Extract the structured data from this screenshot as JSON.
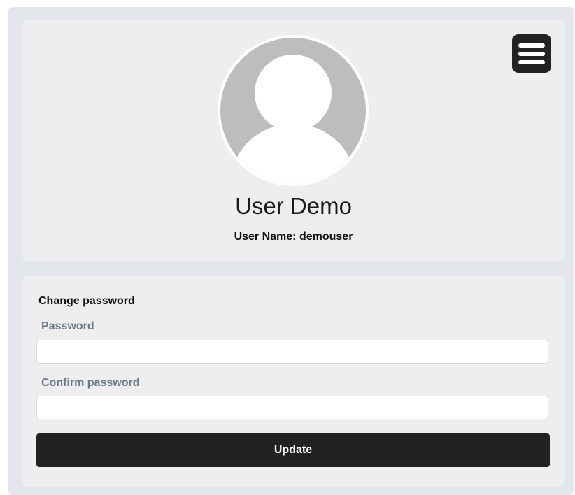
{
  "profile": {
    "display_name": "User Demo",
    "username_label": "User Name:",
    "username": "demouser"
  },
  "menu": {
    "icon": "hamburger-menu-icon"
  },
  "avatar": {
    "icon": "default-user-avatar"
  },
  "change_password": {
    "title": "Change password",
    "password_label": "Password",
    "password_value": "",
    "confirm_label": "Confirm password",
    "confirm_value": "",
    "update_label": "Update"
  },
  "colors": {
    "accent_dark": "#222222",
    "card_bg": "#eeeeee",
    "frame_bg": "#e3e7ec",
    "label_color": "#6a7a8c"
  }
}
